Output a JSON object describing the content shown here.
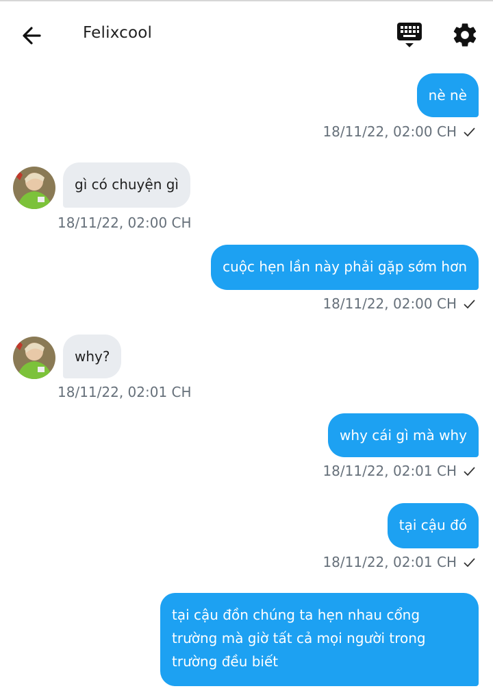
{
  "header": {
    "title": "Felixcool"
  },
  "colors": {
    "outgoing_bubble": "#1da1f2",
    "incoming_bubble": "#e9ecf0",
    "timestamp": "#66707a"
  },
  "icons": {
    "back": "arrow-left-icon",
    "keyboard": "keyboard-icon",
    "settings": "gear-icon",
    "read": "check-icon"
  },
  "messages": [
    {
      "direction": "out",
      "text": "nè nè",
      "time": "18/11/22,  02:00 CH"
    },
    {
      "direction": "in",
      "text": "gì có chuyện gì",
      "time": "18/11/22,  02:00 CH"
    },
    {
      "direction": "out",
      "text": "cuộc hẹn lần này phải gặp sớm hơn",
      "time": "18/11/22,  02:00 CH"
    },
    {
      "direction": "in",
      "text": "why?",
      "time": "18/11/22,  02:01 CH"
    },
    {
      "direction": "out",
      "text": "why cái gì mà why",
      "time": "18/11/22,  02:01 CH"
    },
    {
      "direction": "out",
      "text": "tại cậu đó",
      "time": "18/11/22,  02:01 CH"
    },
    {
      "direction": "out",
      "text": "tại cậu đồn chúng ta hẹn nhau cổng trường mà giờ tất cả mọi người trong trường đều biết",
      "time": ""
    }
  ]
}
